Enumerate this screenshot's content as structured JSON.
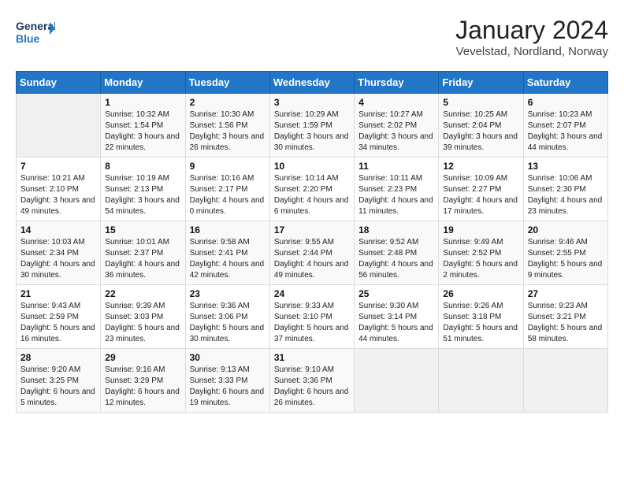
{
  "header": {
    "logo_line1": "General",
    "logo_line2": "Blue",
    "month": "January 2024",
    "location": "Vevelstad, Nordland, Norway"
  },
  "weekdays": [
    "Sunday",
    "Monday",
    "Tuesday",
    "Wednesday",
    "Thursday",
    "Friday",
    "Saturday"
  ],
  "weeks": [
    [
      {
        "day": "",
        "sunrise": "",
        "sunset": "",
        "daylight": ""
      },
      {
        "day": "1",
        "sunrise": "10:32 AM",
        "sunset": "1:54 PM",
        "daylight": "3 hours and 22 minutes."
      },
      {
        "day": "2",
        "sunrise": "10:30 AM",
        "sunset": "1:56 PM",
        "daylight": "3 hours and 26 minutes."
      },
      {
        "day": "3",
        "sunrise": "10:29 AM",
        "sunset": "1:59 PM",
        "daylight": "3 hours and 30 minutes."
      },
      {
        "day": "4",
        "sunrise": "10:27 AM",
        "sunset": "2:02 PM",
        "daylight": "3 hours and 34 minutes."
      },
      {
        "day": "5",
        "sunrise": "10:25 AM",
        "sunset": "2:04 PM",
        "daylight": "3 hours and 39 minutes."
      },
      {
        "day": "6",
        "sunrise": "10:23 AM",
        "sunset": "2:07 PM",
        "daylight": "3 hours and 44 minutes."
      }
    ],
    [
      {
        "day": "7",
        "sunrise": "10:21 AM",
        "sunset": "2:10 PM",
        "daylight": "3 hours and 49 minutes."
      },
      {
        "day": "8",
        "sunrise": "10:19 AM",
        "sunset": "2:13 PM",
        "daylight": "3 hours and 54 minutes."
      },
      {
        "day": "9",
        "sunrise": "10:16 AM",
        "sunset": "2:17 PM",
        "daylight": "4 hours and 0 minutes."
      },
      {
        "day": "10",
        "sunrise": "10:14 AM",
        "sunset": "2:20 PM",
        "daylight": "4 hours and 6 minutes."
      },
      {
        "day": "11",
        "sunrise": "10:11 AM",
        "sunset": "2:23 PM",
        "daylight": "4 hours and 11 minutes."
      },
      {
        "day": "12",
        "sunrise": "10:09 AM",
        "sunset": "2:27 PM",
        "daylight": "4 hours and 17 minutes."
      },
      {
        "day": "13",
        "sunrise": "10:06 AM",
        "sunset": "2:30 PM",
        "daylight": "4 hours and 23 minutes."
      }
    ],
    [
      {
        "day": "14",
        "sunrise": "10:03 AM",
        "sunset": "2:34 PM",
        "daylight": "4 hours and 30 minutes."
      },
      {
        "day": "15",
        "sunrise": "10:01 AM",
        "sunset": "2:37 PM",
        "daylight": "4 hours and 36 minutes."
      },
      {
        "day": "16",
        "sunrise": "9:58 AM",
        "sunset": "2:41 PM",
        "daylight": "4 hours and 42 minutes."
      },
      {
        "day": "17",
        "sunrise": "9:55 AM",
        "sunset": "2:44 PM",
        "daylight": "4 hours and 49 minutes."
      },
      {
        "day": "18",
        "sunrise": "9:52 AM",
        "sunset": "2:48 PM",
        "daylight": "4 hours and 56 minutes."
      },
      {
        "day": "19",
        "sunrise": "9:49 AM",
        "sunset": "2:52 PM",
        "daylight": "5 hours and 2 minutes."
      },
      {
        "day": "20",
        "sunrise": "9:46 AM",
        "sunset": "2:55 PM",
        "daylight": "5 hours and 9 minutes."
      }
    ],
    [
      {
        "day": "21",
        "sunrise": "9:43 AM",
        "sunset": "2:59 PM",
        "daylight": "5 hours and 16 minutes."
      },
      {
        "day": "22",
        "sunrise": "9:39 AM",
        "sunset": "3:03 PM",
        "daylight": "5 hours and 23 minutes."
      },
      {
        "day": "23",
        "sunrise": "9:36 AM",
        "sunset": "3:06 PM",
        "daylight": "5 hours and 30 minutes."
      },
      {
        "day": "24",
        "sunrise": "9:33 AM",
        "sunset": "3:10 PM",
        "daylight": "5 hours and 37 minutes."
      },
      {
        "day": "25",
        "sunrise": "9:30 AM",
        "sunset": "3:14 PM",
        "daylight": "5 hours and 44 minutes."
      },
      {
        "day": "26",
        "sunrise": "9:26 AM",
        "sunset": "3:18 PM",
        "daylight": "5 hours and 51 minutes."
      },
      {
        "day": "27",
        "sunrise": "9:23 AM",
        "sunset": "3:21 PM",
        "daylight": "5 hours and 58 minutes."
      }
    ],
    [
      {
        "day": "28",
        "sunrise": "9:20 AM",
        "sunset": "3:25 PM",
        "daylight": "6 hours and 5 minutes."
      },
      {
        "day": "29",
        "sunrise": "9:16 AM",
        "sunset": "3:29 PM",
        "daylight": "6 hours and 12 minutes."
      },
      {
        "day": "30",
        "sunrise": "9:13 AM",
        "sunset": "3:33 PM",
        "daylight": "6 hours and 19 minutes."
      },
      {
        "day": "31",
        "sunrise": "9:10 AM",
        "sunset": "3:36 PM",
        "daylight": "6 hours and 26 minutes."
      },
      {
        "day": "",
        "sunrise": "",
        "sunset": "",
        "daylight": ""
      },
      {
        "day": "",
        "sunrise": "",
        "sunset": "",
        "daylight": ""
      },
      {
        "day": "",
        "sunrise": "",
        "sunset": "",
        "daylight": ""
      }
    ]
  ]
}
